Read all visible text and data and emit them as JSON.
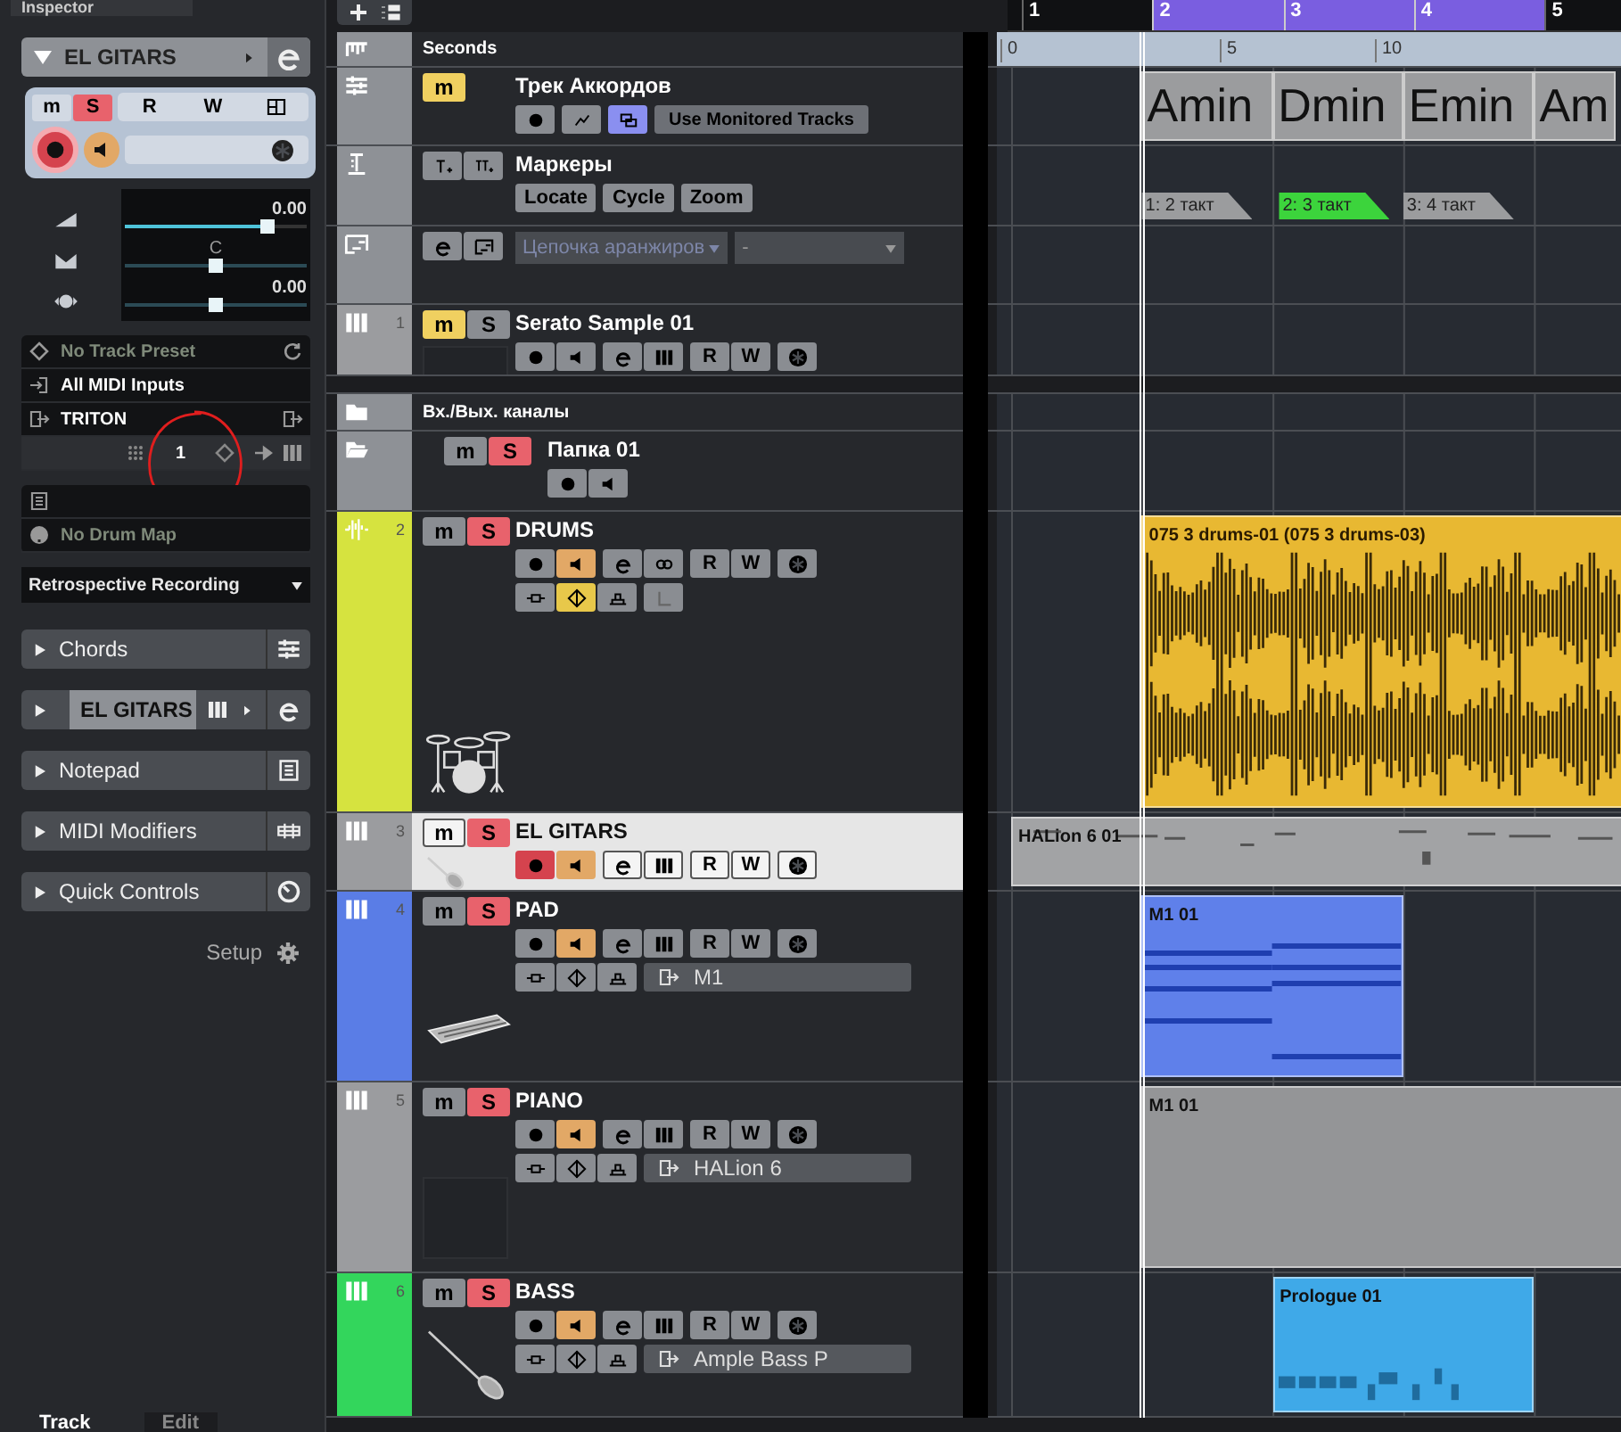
{
  "inspector": {
    "tab": "Inspector",
    "header": {
      "name": "EL GITARS",
      "expanded": true
    },
    "mute": {
      "label": "m",
      "on": false
    },
    "solo": {
      "label": "S",
      "on": true
    },
    "read": "R",
    "write": "W",
    "record": true,
    "monitor": true,
    "faders": [
      {
        "kind": "volume",
        "reading": "0.00",
        "level": 0.78
      },
      {
        "kind": "pan",
        "reading": "C",
        "level": 0.5
      },
      {
        "kind": "delay",
        "reading": "0.00",
        "level": 0.5
      }
    ],
    "track_preset": "No Track Preset",
    "input": "All MIDI Inputs",
    "output": "TRITON",
    "channel": "1",
    "drum_map": "No Drum Map",
    "recording_mode": "Retrospective Recording",
    "sections": [
      {
        "label": "Chords",
        "kind": "chords",
        "expanded": false,
        "selected": false
      },
      {
        "label": "EL GITARS",
        "kind": "instrument",
        "expanded": false,
        "selected": true
      },
      {
        "label": "Notepad",
        "kind": "notepad",
        "expanded": false,
        "selected": false
      },
      {
        "label": "MIDI Modifiers",
        "kind": "modifiers",
        "expanded": false,
        "selected": false
      },
      {
        "label": "Quick Controls",
        "kind": "quick-controls",
        "expanded": false,
        "selected": false
      }
    ],
    "setup": "Setup",
    "bottom_tabs": [
      {
        "label": "Track",
        "selected": true
      },
      {
        "label": "Edit",
        "selected": false
      }
    ]
  },
  "ruler": {
    "bars": [
      {
        "label": "1",
        "in_cycle": false
      },
      {
        "label": "2",
        "in_cycle": true
      },
      {
        "label": "3",
        "in_cycle": true
      },
      {
        "label": "4",
        "in_cycle": true
      },
      {
        "label": "5",
        "in_cycle": false
      }
    ],
    "seconds": [
      "0",
      "5",
      "10"
    ]
  },
  "tracks": [
    {
      "kind": "ruler",
      "name": "Seconds"
    },
    {
      "kind": "chord",
      "name": "Трек Аккордов",
      "mute": {
        "label": "m",
        "on": true
      },
      "record": false,
      "monitored_on": true,
      "monitored_field": "Use Monitored Tracks",
      "events": [
        {
          "label": "Amin"
        },
        {
          "label": "Dmin"
        },
        {
          "label": "Emin"
        },
        {
          "label": "Am"
        }
      ]
    },
    {
      "kind": "marker",
      "name": "Маркеры",
      "buttons": [
        "Locate",
        "Cycle",
        "Zoom"
      ],
      "events": [
        {
          "label": "1: 2 такт",
          "selected": false
        },
        {
          "label": "2: 3 такт",
          "selected": true
        },
        {
          "label": "3: 4 такт",
          "selected": false
        }
      ]
    },
    {
      "kind": "arranger",
      "chain": "Цепочка аранжиров",
      "section": "-"
    },
    {
      "kind": "instrument",
      "number": "1",
      "name": "Serato Sample 01",
      "color": "#9b9c9f",
      "selected": false,
      "mute": {
        "label": "m",
        "on": true
      },
      "solo": {
        "label": "S",
        "on": false
      },
      "record": false,
      "monitor": false,
      "read": "R",
      "write": "W"
    },
    {
      "kind": "folder-header",
      "name": "Вх./Вых. каналы"
    },
    {
      "kind": "folder",
      "name": "Папка 01",
      "mute": {
        "label": "m",
        "on": false
      },
      "solo": {
        "label": "S",
        "on": true
      },
      "record": false,
      "monitor": false
    },
    {
      "kind": "audio",
      "number": "2",
      "name": "DRUMS",
      "color": "#d6e33f",
      "selected": false,
      "mute": {
        "label": "m",
        "on": false
      },
      "solo": {
        "label": "S",
        "on": true
      },
      "record": false,
      "monitor": true,
      "read": "R",
      "write": "W",
      "tools": [
        {
          "kind": "insert",
          "on": false
        },
        {
          "kind": "diamond",
          "on": true
        },
        {
          "kind": "eq",
          "on": false
        },
        {
          "kind": "corner",
          "on": false
        }
      ],
      "events": [
        {
          "label": "075 3 drums-01 (075 3 drums-03)",
          "color": "#e8b832"
        }
      ]
    },
    {
      "kind": "instrument",
      "number": "3",
      "name": "EL GITARS",
      "color": "#9b9c9f",
      "selected": true,
      "mute": {
        "label": "m",
        "on": false
      },
      "solo": {
        "label": "S",
        "on": true
      },
      "record": true,
      "monitor": true,
      "read": "R",
      "write": "W",
      "events": [
        {
          "label": "HALion 6 01",
          "color": "#a2a3a5"
        }
      ]
    },
    {
      "kind": "instrument",
      "number": "4",
      "name": "PAD",
      "color": "#5a7de6",
      "selected": false,
      "mute": {
        "label": "m",
        "on": false
      },
      "solo": {
        "label": "S",
        "on": true
      },
      "record": false,
      "monitor": true,
      "read": "R",
      "write": "W",
      "tools": [
        {
          "kind": "insert",
          "on": false
        },
        {
          "kind": "diamond",
          "on": false
        },
        {
          "kind": "eq",
          "on": false
        }
      ],
      "output": "M1",
      "events": [
        {
          "label": "M1 01",
          "color": "#5f80ea"
        }
      ]
    },
    {
      "kind": "instrument",
      "number": "5",
      "name": "PIANO",
      "color": "#9b9c9f",
      "selected": false,
      "mute": {
        "label": "m",
        "on": false
      },
      "solo": {
        "label": "S",
        "on": true
      },
      "record": false,
      "monitor": true,
      "read": "R",
      "write": "W",
      "tools": [
        {
          "kind": "insert",
          "on": false
        },
        {
          "kind": "diamond",
          "on": false
        },
        {
          "kind": "eq",
          "on": false
        }
      ],
      "output": "HALion 6",
      "events": [
        {
          "label": "M1 01",
          "color": "#949597"
        }
      ]
    },
    {
      "kind": "instrument",
      "number": "6",
      "name": "BASS",
      "color": "#33d65c",
      "selected": false,
      "mute": {
        "label": "m",
        "on": false
      },
      "solo": {
        "label": "S",
        "on": true
      },
      "record": false,
      "monitor": true,
      "read": "R",
      "write": "W",
      "tools": [
        {
          "kind": "insert",
          "on": false
        },
        {
          "kind": "diamond",
          "on": false
        },
        {
          "kind": "eq",
          "on": false
        }
      ],
      "output": "Ample Bass P",
      "events": [
        {
          "label": "Prologue 01",
          "color": "#3fa9e8"
        }
      ]
    }
  ]
}
